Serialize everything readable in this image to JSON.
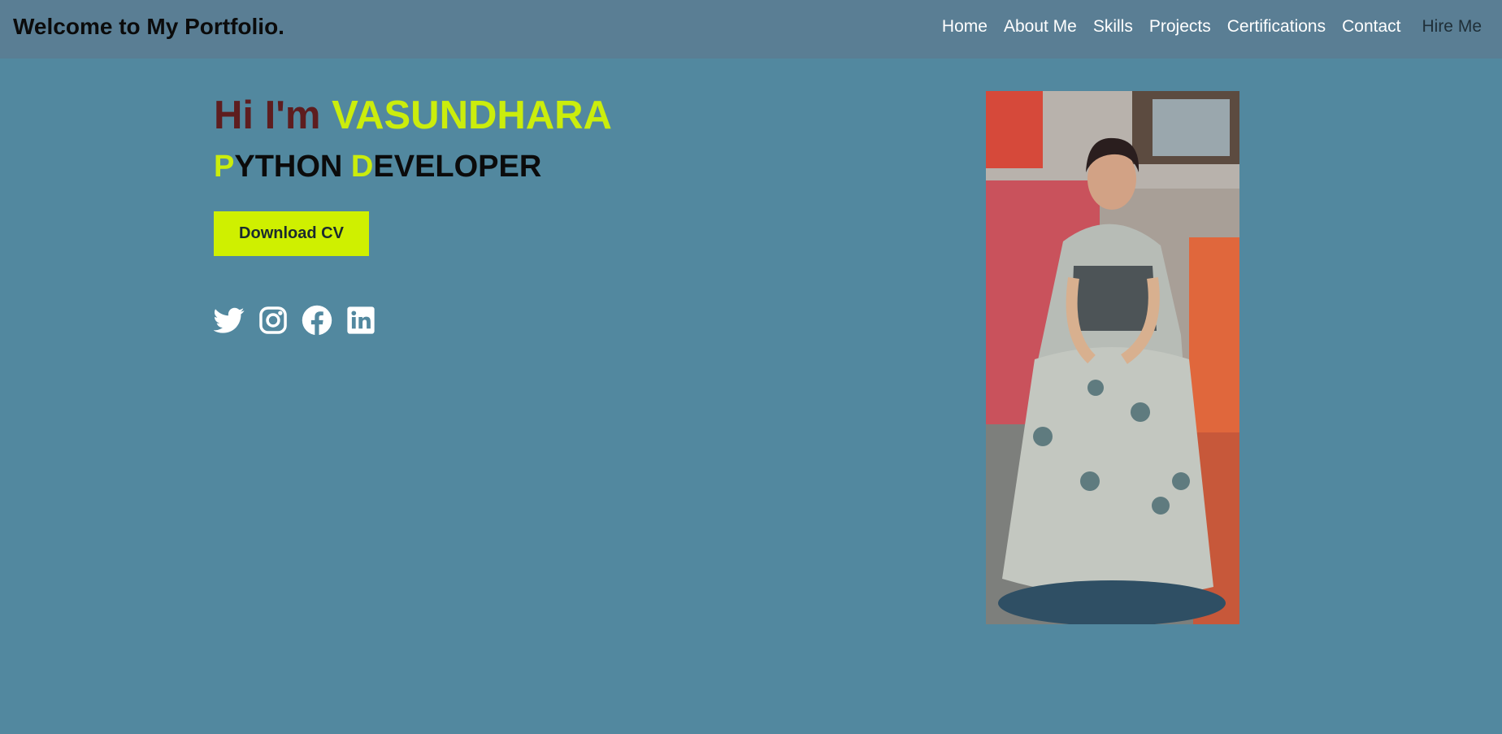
{
  "header": {
    "brand": "Welcome to My Portfolio.",
    "nav": [
      {
        "label": "Home"
      },
      {
        "label": "About Me"
      },
      {
        "label": "Skills"
      },
      {
        "label": "Projects"
      },
      {
        "label": "Certifications"
      },
      {
        "label": "Contact"
      }
    ],
    "hire_label": "Hire Me"
  },
  "hero": {
    "greeting": "Hi I'm ",
    "name": "VASUNDHARA",
    "role": {
      "word1_initial": "P",
      "word1_rest": "YTHON ",
      "word2_initial": "D",
      "word2_rest": "EVELOPER"
    },
    "cv_button": "Download CV",
    "socials": [
      {
        "icon": "twitter-icon"
      },
      {
        "icon": "instagram-icon"
      },
      {
        "icon": "facebook-icon"
      },
      {
        "icon": "linkedin-icon"
      }
    ]
  },
  "colors": {
    "page_background": "#52889f",
    "navbar_background": "#5a7e94",
    "accent": "#cbed0c",
    "greeting": "#5e1d1f",
    "button": "#cff000"
  }
}
